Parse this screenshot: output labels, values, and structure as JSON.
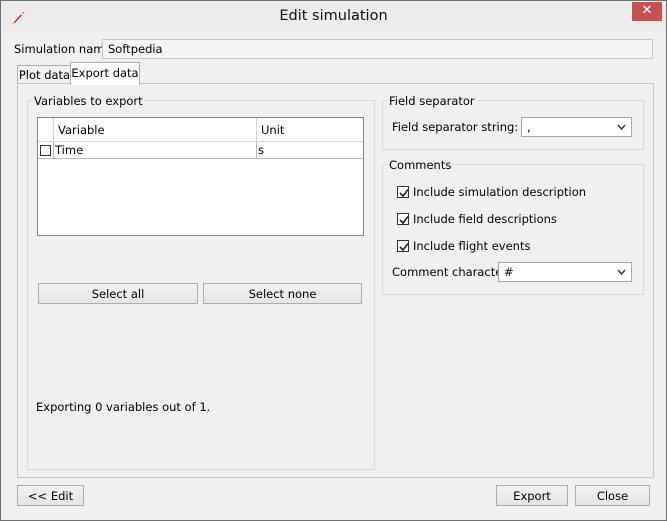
{
  "window": {
    "title": "Edit simulation",
    "close_glyph": "✕"
  },
  "sim_name": {
    "label": "Simulation name:",
    "value": "Softpedia"
  },
  "tabs": [
    {
      "label": "Plot data"
    },
    {
      "label": "Export data"
    }
  ],
  "variables": {
    "group_title": "Variables to export",
    "columns": {
      "variable": "Variable",
      "unit": "Unit"
    },
    "rows": [
      {
        "variable": "Time",
        "unit": "s",
        "checked": false
      }
    ],
    "select_all": "Select all",
    "select_none": "Select none",
    "status": "Exporting 0 variables out of 1."
  },
  "field_separator": {
    "group_title": "Field separator",
    "label": "Field separator string:",
    "value": ","
  },
  "comments": {
    "group_title": "Comments",
    "include_description": "Include simulation description",
    "include_field_descriptions": "Include field descriptions",
    "include_flight_events": "Include flight events",
    "comment_char_label": "Comment character:",
    "comment_char_value": "#"
  },
  "buttons": {
    "edit": "<< Edit",
    "export": "Export",
    "close": "Close"
  },
  "colors": {
    "close_red": "#c75050",
    "window_bg": "#f0f0f0"
  }
}
